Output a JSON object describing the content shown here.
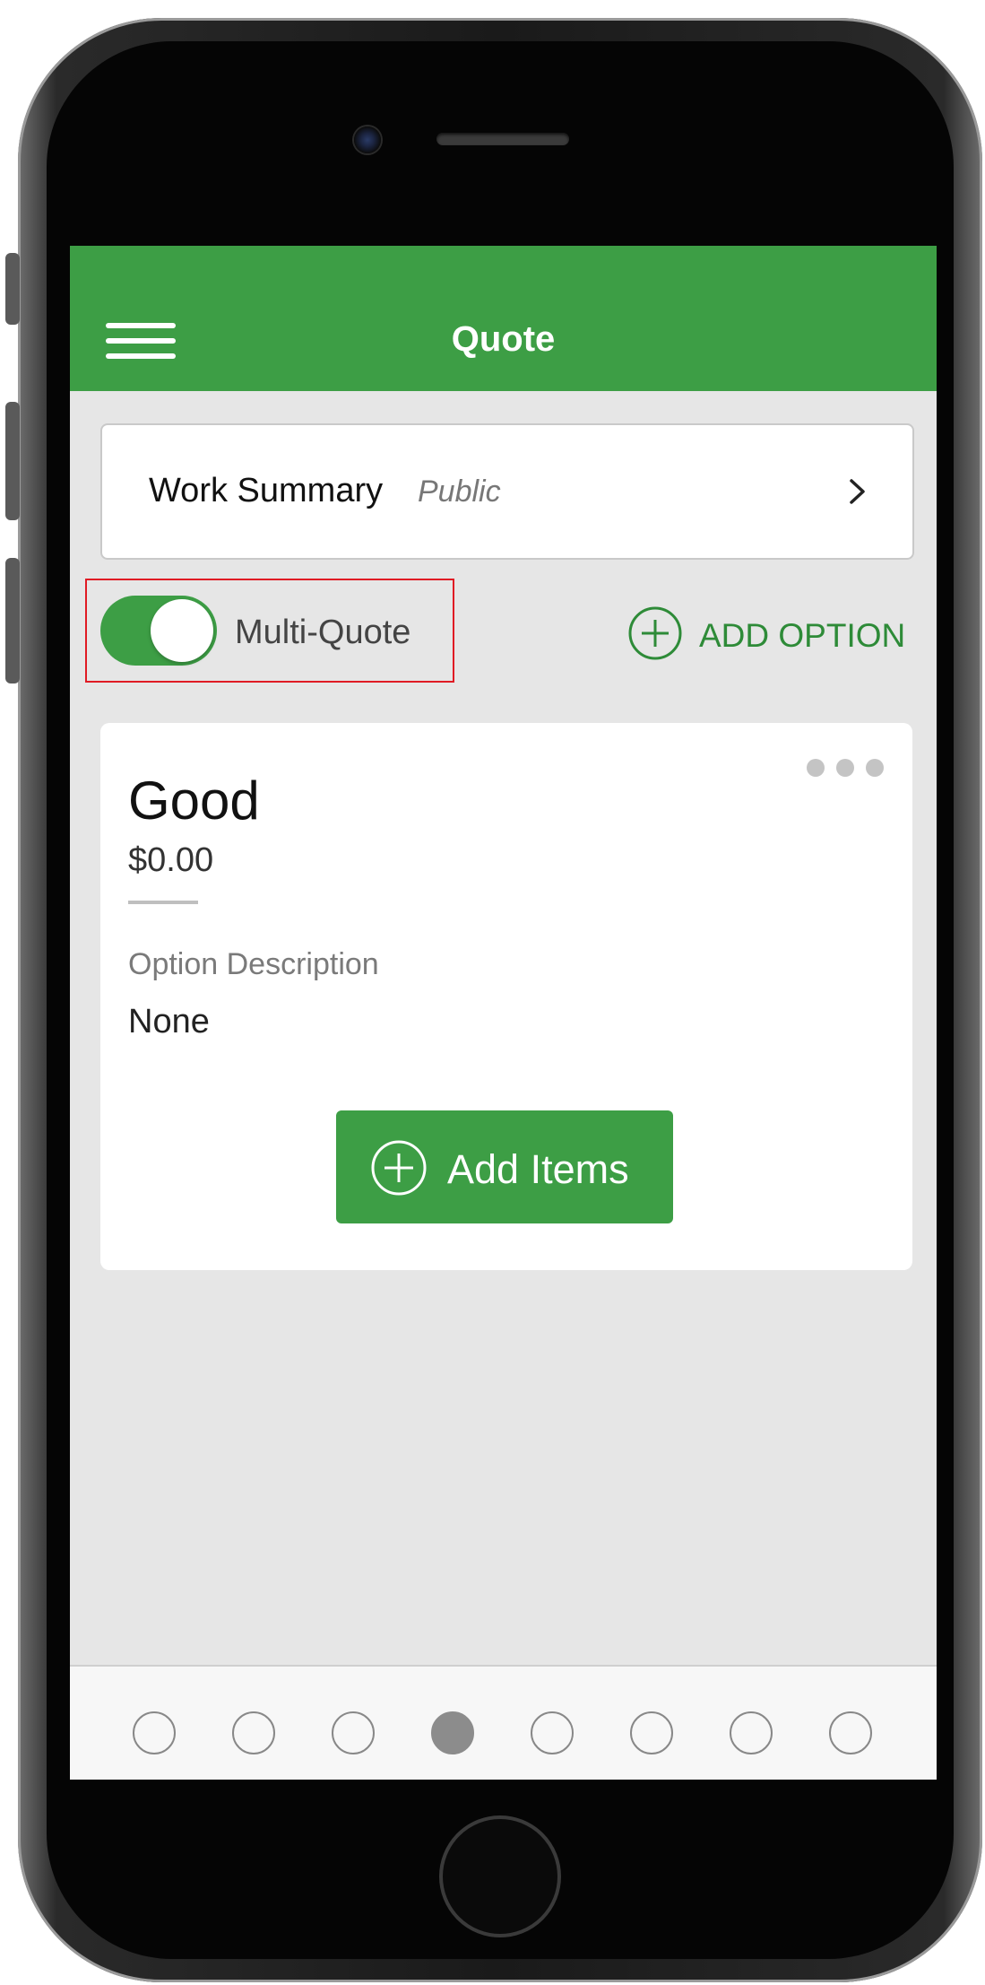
{
  "nav": {
    "title": "Quote",
    "menu_icon": "hamburger-menu-icon",
    "bar_color": "#3d9e45"
  },
  "work_summary": {
    "label": "Work Summary",
    "visibility": "Public",
    "chevron_icon": "chevron-right-icon"
  },
  "multi_quote": {
    "label": "Multi-Quote",
    "enabled": true,
    "highlighted": true
  },
  "add_option": {
    "label": "ADD OPTION",
    "icon": "plus-circle-icon"
  },
  "option": {
    "name": "Good",
    "price": "$0.00",
    "description_label": "Option Description",
    "description_value": "None",
    "more_icon": "more-horizontal-icon",
    "add_items_label": "Add Items"
  },
  "pagination": {
    "total": 8,
    "active_index": 3
  },
  "colors": {
    "accent": "#3d9e45",
    "highlight": "#e01b24",
    "background": "#e6e6e6"
  }
}
